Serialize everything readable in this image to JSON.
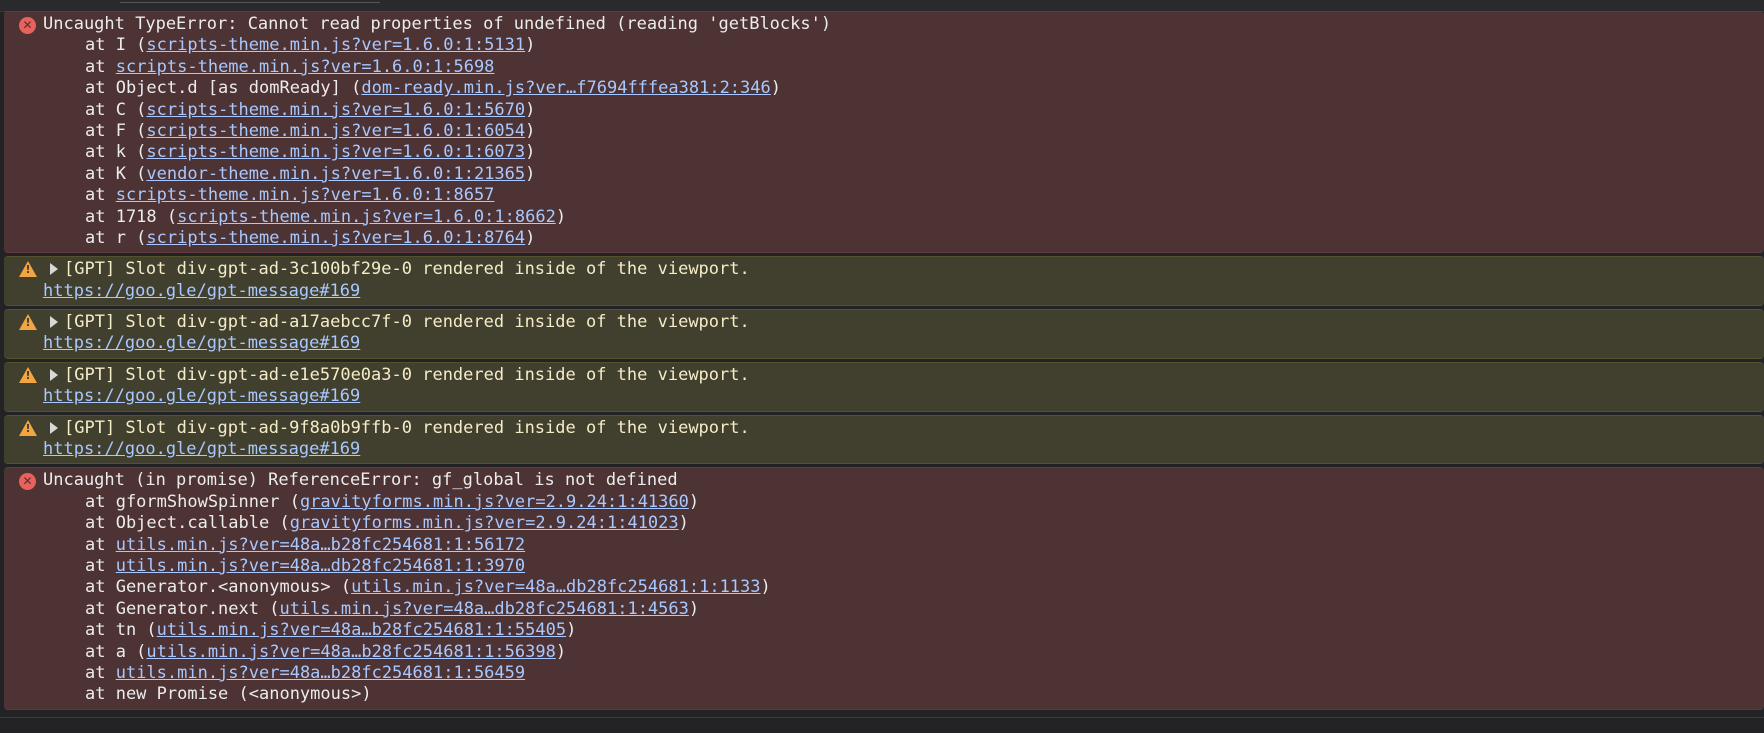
{
  "colors": {
    "error_bg": "#4d3334",
    "warning_bg": "#413f2e",
    "link": "#a8c8ff",
    "error_icon": "#e8615c",
    "warning_icon": "#f2a541"
  },
  "messages": [
    {
      "type": "error",
      "icon": "error-circle-icon",
      "text": "Uncaught TypeError: Cannot read properties of undefined (reading 'getBlocks')",
      "stack": [
        {
          "prefix": "at I (",
          "link": "scripts-theme.min.js?ver=1.6.0:1:5131",
          "suffix": ")"
        },
        {
          "prefix": "at ",
          "link": "scripts-theme.min.js?ver=1.6.0:1:5698",
          "suffix": ""
        },
        {
          "prefix": "at Object.d [as domReady] (",
          "link": "dom-ready.min.js?ver…f7694fffea381:2:346",
          "suffix": ")"
        },
        {
          "prefix": "at C (",
          "link": "scripts-theme.min.js?ver=1.6.0:1:5670",
          "suffix": ")"
        },
        {
          "prefix": "at F (",
          "link": "scripts-theme.min.js?ver=1.6.0:1:6054",
          "suffix": ")"
        },
        {
          "prefix": "at k (",
          "link": "scripts-theme.min.js?ver=1.6.0:1:6073",
          "suffix": ")"
        },
        {
          "prefix": "at K (",
          "link": "vendor-theme.min.js?ver=1.6.0:1:21365",
          "suffix": ")"
        },
        {
          "prefix": "at ",
          "link": "scripts-theme.min.js?ver=1.6.0:1:8657",
          "suffix": ""
        },
        {
          "prefix": "at 1718 (",
          "link": "scripts-theme.min.js?ver=1.6.0:1:8662",
          "suffix": ")"
        },
        {
          "prefix": "at r (",
          "link": "scripts-theme.min.js?ver=1.6.0:1:8764",
          "suffix": ")"
        }
      ]
    },
    {
      "type": "warning",
      "icon": "warning-triangle-icon",
      "text": "[GPT] Slot div-gpt-ad-3c100bf29e-0 rendered inside of the viewport.",
      "link": "https://goo.gle/gpt-message#169"
    },
    {
      "type": "warning",
      "icon": "warning-triangle-icon",
      "text": "[GPT] Slot div-gpt-ad-a17aebcc7f-0 rendered inside of the viewport.",
      "link": "https://goo.gle/gpt-message#169"
    },
    {
      "type": "warning",
      "icon": "warning-triangle-icon",
      "text": "[GPT] Slot div-gpt-ad-e1e570e0a3-0 rendered inside of the viewport.",
      "link": "https://goo.gle/gpt-message#169"
    },
    {
      "type": "warning",
      "icon": "warning-triangle-icon",
      "text": "[GPT] Slot div-gpt-ad-9f8a0b9ffb-0 rendered inside of the viewport.",
      "link": "https://goo.gle/gpt-message#169"
    },
    {
      "type": "error",
      "icon": "error-circle-icon",
      "text": "Uncaught (in promise) ReferenceError: gf_global is not defined",
      "stack": [
        {
          "prefix": "at gformShowSpinner (",
          "link": "gravityforms.min.js?ver=2.9.24:1:41360",
          "suffix": ")"
        },
        {
          "prefix": "at Object.callable (",
          "link": "gravityforms.min.js?ver=2.9.24:1:41023",
          "suffix": ")"
        },
        {
          "prefix": "at ",
          "link": "utils.min.js?ver=48a…b28fc254681:1:56172",
          "suffix": ""
        },
        {
          "prefix": "at ",
          "link": "utils.min.js?ver=48a…db28fc254681:1:3970",
          "suffix": ""
        },
        {
          "prefix": "at Generator.<anonymous> (",
          "link": "utils.min.js?ver=48a…db28fc254681:1:1133",
          "suffix": ")"
        },
        {
          "prefix": "at Generator.next (",
          "link": "utils.min.js?ver=48a…db28fc254681:1:4563",
          "suffix": ")"
        },
        {
          "prefix": "at tn (",
          "link": "utils.min.js?ver=48a…b28fc254681:1:55405",
          "suffix": ")"
        },
        {
          "prefix": "at a (",
          "link": "utils.min.js?ver=48a…b28fc254681:1:56398",
          "suffix": ")"
        },
        {
          "prefix": "at ",
          "link": "utils.min.js?ver=48a…b28fc254681:1:56459",
          "suffix": ""
        },
        {
          "prefix": "at new Promise (<anonymous>)",
          "link": "",
          "suffix": ""
        }
      ]
    }
  ]
}
